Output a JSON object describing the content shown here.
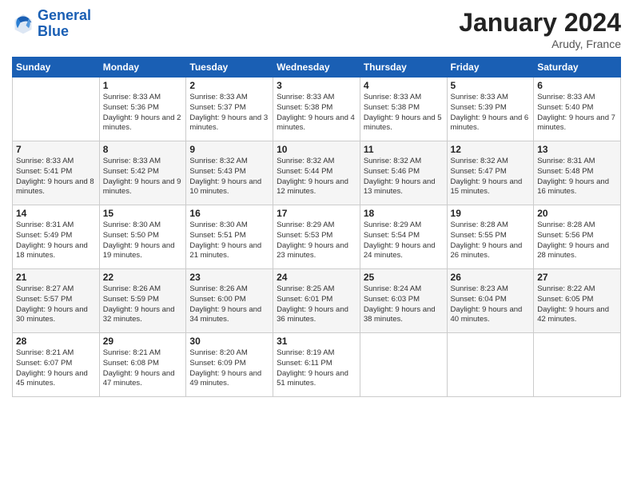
{
  "header": {
    "logo_line1": "General",
    "logo_line2": "Blue",
    "title": "January 2024",
    "subtitle": "Arudy, France"
  },
  "weekdays": [
    "Sunday",
    "Monday",
    "Tuesday",
    "Wednesday",
    "Thursday",
    "Friday",
    "Saturday"
  ],
  "weeks": [
    [
      {
        "day": "",
        "sunrise": "",
        "sunset": "",
        "daylight": ""
      },
      {
        "day": "1",
        "sunrise": "Sunrise: 8:33 AM",
        "sunset": "Sunset: 5:36 PM",
        "daylight": "Daylight: 9 hours and 2 minutes."
      },
      {
        "day": "2",
        "sunrise": "Sunrise: 8:33 AM",
        "sunset": "Sunset: 5:37 PM",
        "daylight": "Daylight: 9 hours and 3 minutes."
      },
      {
        "day": "3",
        "sunrise": "Sunrise: 8:33 AM",
        "sunset": "Sunset: 5:38 PM",
        "daylight": "Daylight: 9 hours and 4 minutes."
      },
      {
        "day": "4",
        "sunrise": "Sunrise: 8:33 AM",
        "sunset": "Sunset: 5:38 PM",
        "daylight": "Daylight: 9 hours and 5 minutes."
      },
      {
        "day": "5",
        "sunrise": "Sunrise: 8:33 AM",
        "sunset": "Sunset: 5:39 PM",
        "daylight": "Daylight: 9 hours and 6 minutes."
      },
      {
        "day": "6",
        "sunrise": "Sunrise: 8:33 AM",
        "sunset": "Sunset: 5:40 PM",
        "daylight": "Daylight: 9 hours and 7 minutes."
      }
    ],
    [
      {
        "day": "7",
        "sunrise": "Sunrise: 8:33 AM",
        "sunset": "Sunset: 5:41 PM",
        "daylight": "Daylight: 9 hours and 8 minutes."
      },
      {
        "day": "8",
        "sunrise": "Sunrise: 8:33 AM",
        "sunset": "Sunset: 5:42 PM",
        "daylight": "Daylight: 9 hours and 9 minutes."
      },
      {
        "day": "9",
        "sunrise": "Sunrise: 8:32 AM",
        "sunset": "Sunset: 5:43 PM",
        "daylight": "Daylight: 9 hours and 10 minutes."
      },
      {
        "day": "10",
        "sunrise": "Sunrise: 8:32 AM",
        "sunset": "Sunset: 5:44 PM",
        "daylight": "Daylight: 9 hours and 12 minutes."
      },
      {
        "day": "11",
        "sunrise": "Sunrise: 8:32 AM",
        "sunset": "Sunset: 5:46 PM",
        "daylight": "Daylight: 9 hours and 13 minutes."
      },
      {
        "day": "12",
        "sunrise": "Sunrise: 8:32 AM",
        "sunset": "Sunset: 5:47 PM",
        "daylight": "Daylight: 9 hours and 15 minutes."
      },
      {
        "day": "13",
        "sunrise": "Sunrise: 8:31 AM",
        "sunset": "Sunset: 5:48 PM",
        "daylight": "Daylight: 9 hours and 16 minutes."
      }
    ],
    [
      {
        "day": "14",
        "sunrise": "Sunrise: 8:31 AM",
        "sunset": "Sunset: 5:49 PM",
        "daylight": "Daylight: 9 hours and 18 minutes."
      },
      {
        "day": "15",
        "sunrise": "Sunrise: 8:30 AM",
        "sunset": "Sunset: 5:50 PM",
        "daylight": "Daylight: 9 hours and 19 minutes."
      },
      {
        "day": "16",
        "sunrise": "Sunrise: 8:30 AM",
        "sunset": "Sunset: 5:51 PM",
        "daylight": "Daylight: 9 hours and 21 minutes."
      },
      {
        "day": "17",
        "sunrise": "Sunrise: 8:29 AM",
        "sunset": "Sunset: 5:53 PM",
        "daylight": "Daylight: 9 hours and 23 minutes."
      },
      {
        "day": "18",
        "sunrise": "Sunrise: 8:29 AM",
        "sunset": "Sunset: 5:54 PM",
        "daylight": "Daylight: 9 hours and 24 minutes."
      },
      {
        "day": "19",
        "sunrise": "Sunrise: 8:28 AM",
        "sunset": "Sunset: 5:55 PM",
        "daylight": "Daylight: 9 hours and 26 minutes."
      },
      {
        "day": "20",
        "sunrise": "Sunrise: 8:28 AM",
        "sunset": "Sunset: 5:56 PM",
        "daylight": "Daylight: 9 hours and 28 minutes."
      }
    ],
    [
      {
        "day": "21",
        "sunrise": "Sunrise: 8:27 AM",
        "sunset": "Sunset: 5:57 PM",
        "daylight": "Daylight: 9 hours and 30 minutes."
      },
      {
        "day": "22",
        "sunrise": "Sunrise: 8:26 AM",
        "sunset": "Sunset: 5:59 PM",
        "daylight": "Daylight: 9 hours and 32 minutes."
      },
      {
        "day": "23",
        "sunrise": "Sunrise: 8:26 AM",
        "sunset": "Sunset: 6:00 PM",
        "daylight": "Daylight: 9 hours and 34 minutes."
      },
      {
        "day": "24",
        "sunrise": "Sunrise: 8:25 AM",
        "sunset": "Sunset: 6:01 PM",
        "daylight": "Daylight: 9 hours and 36 minutes."
      },
      {
        "day": "25",
        "sunrise": "Sunrise: 8:24 AM",
        "sunset": "Sunset: 6:03 PM",
        "daylight": "Daylight: 9 hours and 38 minutes."
      },
      {
        "day": "26",
        "sunrise": "Sunrise: 8:23 AM",
        "sunset": "Sunset: 6:04 PM",
        "daylight": "Daylight: 9 hours and 40 minutes."
      },
      {
        "day": "27",
        "sunrise": "Sunrise: 8:22 AM",
        "sunset": "Sunset: 6:05 PM",
        "daylight": "Daylight: 9 hours and 42 minutes."
      }
    ],
    [
      {
        "day": "28",
        "sunrise": "Sunrise: 8:21 AM",
        "sunset": "Sunset: 6:07 PM",
        "daylight": "Daylight: 9 hours and 45 minutes."
      },
      {
        "day": "29",
        "sunrise": "Sunrise: 8:21 AM",
        "sunset": "Sunset: 6:08 PM",
        "daylight": "Daylight: 9 hours and 47 minutes."
      },
      {
        "day": "30",
        "sunrise": "Sunrise: 8:20 AM",
        "sunset": "Sunset: 6:09 PM",
        "daylight": "Daylight: 9 hours and 49 minutes."
      },
      {
        "day": "31",
        "sunrise": "Sunrise: 8:19 AM",
        "sunset": "Sunset: 6:11 PM",
        "daylight": "Daylight: 9 hours and 51 minutes."
      },
      {
        "day": "",
        "sunrise": "",
        "sunset": "",
        "daylight": ""
      },
      {
        "day": "",
        "sunrise": "",
        "sunset": "",
        "daylight": ""
      },
      {
        "day": "",
        "sunrise": "",
        "sunset": "",
        "daylight": ""
      }
    ]
  ]
}
